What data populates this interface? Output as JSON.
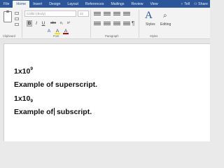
{
  "tabs": [
    "File",
    "Home",
    "Insert",
    "Design",
    "Layout",
    "References",
    "Mailings",
    "Review",
    "View"
  ],
  "active_tab": "Home",
  "tell_me": "Tell",
  "share_label": "Share",
  "ribbon": {
    "font_name": "Calibri (Body)",
    "font_size": "22",
    "group_labels": {
      "clipboard": "Clipboard",
      "font": "Font",
      "paragraph": "Paragraph",
      "styles": "Styles"
    },
    "styles_button": "Styles",
    "editing_button": "Editing",
    "format_buttons": [
      "B",
      "I",
      "U",
      "abc",
      "x₂",
      "x²",
      "A",
      "A",
      "A"
    ]
  },
  "document": {
    "line1_base": "1x10",
    "line1_sup": "9",
    "line2": "Example of superscript.",
    "line3_base": "1x10",
    "line3_sub": "9",
    "line4_before": "Example of",
    "line4_after": " subscript."
  }
}
